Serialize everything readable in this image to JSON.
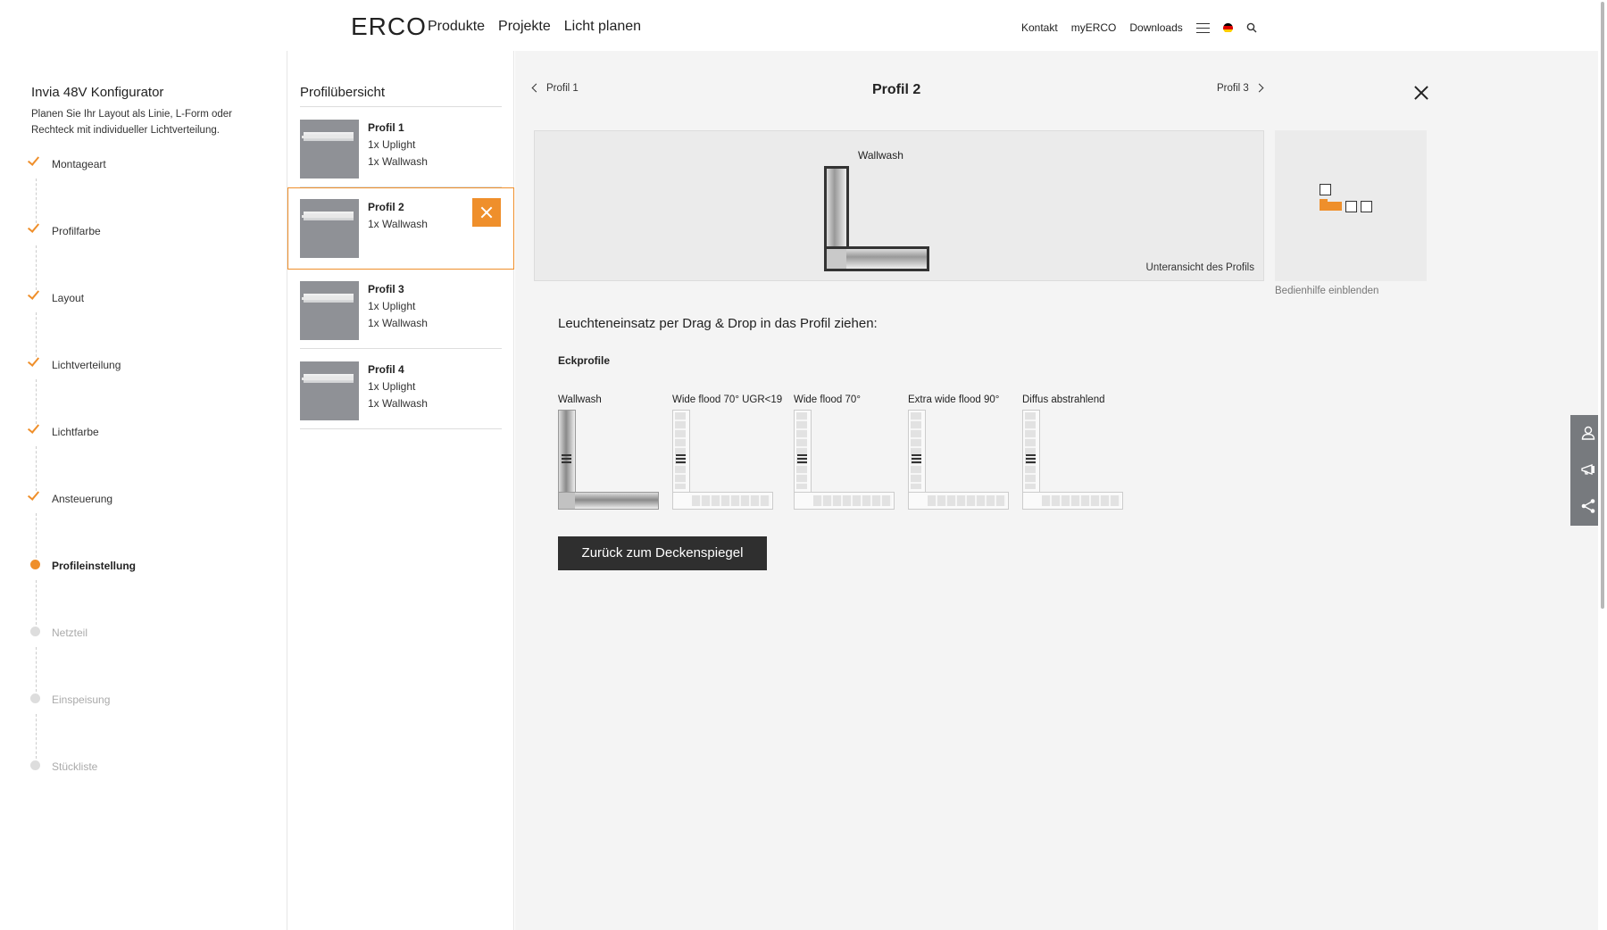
{
  "header": {
    "logo": "ERCO",
    "main_nav": [
      "Produkte",
      "Projekte",
      "Licht planen"
    ],
    "sub_nav": [
      "Kontakt",
      "myERCO",
      "Downloads"
    ],
    "icons": [
      "menu-icon",
      "flag-de-icon",
      "search-icon"
    ]
  },
  "sidebar": {
    "title": "Invia 48V Konfigurator",
    "description": "Planen Sie Ihr Layout als Linie, L-Form oder Rechteck mit individueller Lichtverteilung.",
    "steps": [
      {
        "label": "Montageart",
        "state": "done"
      },
      {
        "label": "Profilfarbe",
        "state": "done"
      },
      {
        "label": "Layout",
        "state": "done"
      },
      {
        "label": "Lichtverteilung",
        "state": "done"
      },
      {
        "label": "Lichtfarbe",
        "state": "done"
      },
      {
        "label": "Ansteuerung",
        "state": "done"
      },
      {
        "label": "Profileinstellung",
        "state": "active"
      },
      {
        "label": "Netzteil",
        "state": "pending"
      },
      {
        "label": "Einspeisung",
        "state": "pending"
      },
      {
        "label": "Stückliste",
        "state": "pending"
      }
    ]
  },
  "overview": {
    "title": "Profilübersicht",
    "profiles": [
      {
        "name": "Profil 1",
        "lines": [
          "1x Uplight",
          "1x Wallwash"
        ]
      },
      {
        "name": "Profil 2",
        "lines": [
          "1x Wallwash"
        ],
        "selected": true
      },
      {
        "name": "Profil 3",
        "lines": [
          "1x Uplight",
          "1x Wallwash"
        ]
      },
      {
        "name": "Profil 4",
        "lines": [
          "1x Uplight",
          "1x Wallwash"
        ]
      }
    ]
  },
  "main": {
    "prev": "Profil 1",
    "title": "Profil 2",
    "next": "Profil 3",
    "preview_label": "Wallwash",
    "preview_caption": "Unteransicht des Profils",
    "help_label": "Bedienhilfe einblenden",
    "dragdrop_title": "Leuchteneinsatz per Drag & Drop in das Profil ziehen:",
    "section": "Eckprofile",
    "options": [
      "Wallwash",
      "Wide flood 70° UGR<19",
      "Wide flood 70°",
      "Extra wide flood 90°",
      "Diffus abstrahlend"
    ],
    "back_button": "Zurück zum Deckenspiegel"
  },
  "colors": {
    "accent": "#ef8f2b",
    "dark_button": "#2f2f2f",
    "panel_bg": "#f4f4f4"
  }
}
